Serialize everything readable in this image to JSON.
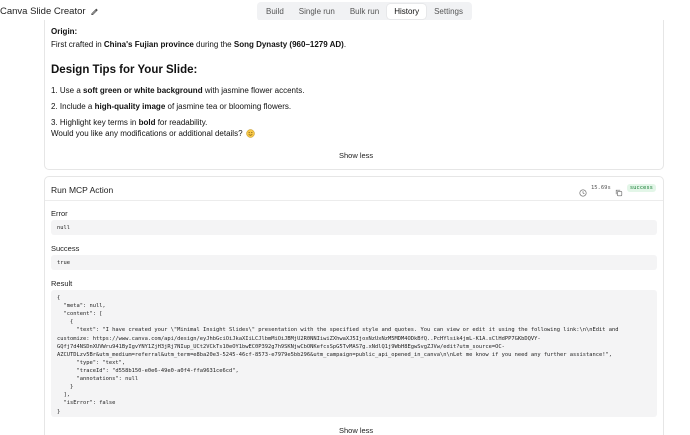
{
  "header": {
    "app_title": "Canva Slide Creator",
    "edit_icon": "pencil-icon",
    "tabs": [
      {
        "label": "Build",
        "active": false
      },
      {
        "label": "Single run",
        "active": false
      },
      {
        "label": "Bulk run",
        "active": false
      },
      {
        "label": "History",
        "active": true
      },
      {
        "label": "Settings",
        "active": false
      }
    ]
  },
  "response": {
    "origin_label": "Origin:",
    "origin_prefix": "First crafted in ",
    "origin_place": "China's Fujian province",
    "origin_mid": " during the ",
    "origin_era": "Song Dynasty (960–1279 AD)",
    "origin_end": ".",
    "design_heading": "Design Tips for Your Slide:",
    "tips": [
      {
        "pre": "1. Use a ",
        "bold": "soft green or white background",
        "post": " with jasmine flower accents."
      },
      {
        "pre": "2. Include a ",
        "bold": "high-quality image",
        "post": " of jasmine tea or blooming flowers."
      },
      {
        "pre": "3. Highlight key terms in ",
        "bold": "bold",
        "post": " for readability."
      }
    ],
    "question": "Would you like any modifications or additional details?",
    "emoji_icon": "smiling-face-icon",
    "show_less": "Show less"
  },
  "mcp": {
    "title": "Run MCP Action",
    "duration": "15.69s",
    "status": "success",
    "status_color": "#1a7f37",
    "error_label": "Error",
    "error_value": "null",
    "success_label": "Success",
    "success_value": "true",
    "result_label": "Result",
    "result_text": "{\n  \"meta\": null,\n  \"content\": [\n    {\n      \"text\": \"I have created your \\\"Minimal Insight Slides\\\" presentation with the specified style and quotes. You can view or edit it using the following link:\\n\\nEdit and\ncustomize: https://www.canva.com/api/design/eyJhbGciOiJkaXIiLCJlbmMiOiJBMjU2R0NNIiwiZXhwaXJ5IjoxNzUxNzM5MDM4ODkBfQ..PcHYlsik4jmL-K1A.sClHdPP7GKbDQVY-\nGQfj7d4NSDnXUVWru941ByIgvYNY1ZjH3jRj7NIup_UCt2VCkTs10eOY1bwEC0P392g7h9SKNjwCbONKefcsSpG5TvMAS7g.xNdlQ1j9WbH8EgwSvgZJVw/edit?utm_source=OC-\nAZCUTDLzv5Br&utm_medium=referral&utm_term=e8ba20e3-5245-46cf-8573-e7979e5bb296&utm_campaign=public_api_opened_in_canva\\n\\nLet me know if you need any further assistance!\",\n      \"type\": \"text\",\n      \"traceId\": \"d558b150-e0e6-49e0-a0f4-ffa9631ce6cd\",\n      \"annotations\": null\n    }\n  ],\n  \"isError\": false\n}",
    "show_less": "Show less"
  }
}
